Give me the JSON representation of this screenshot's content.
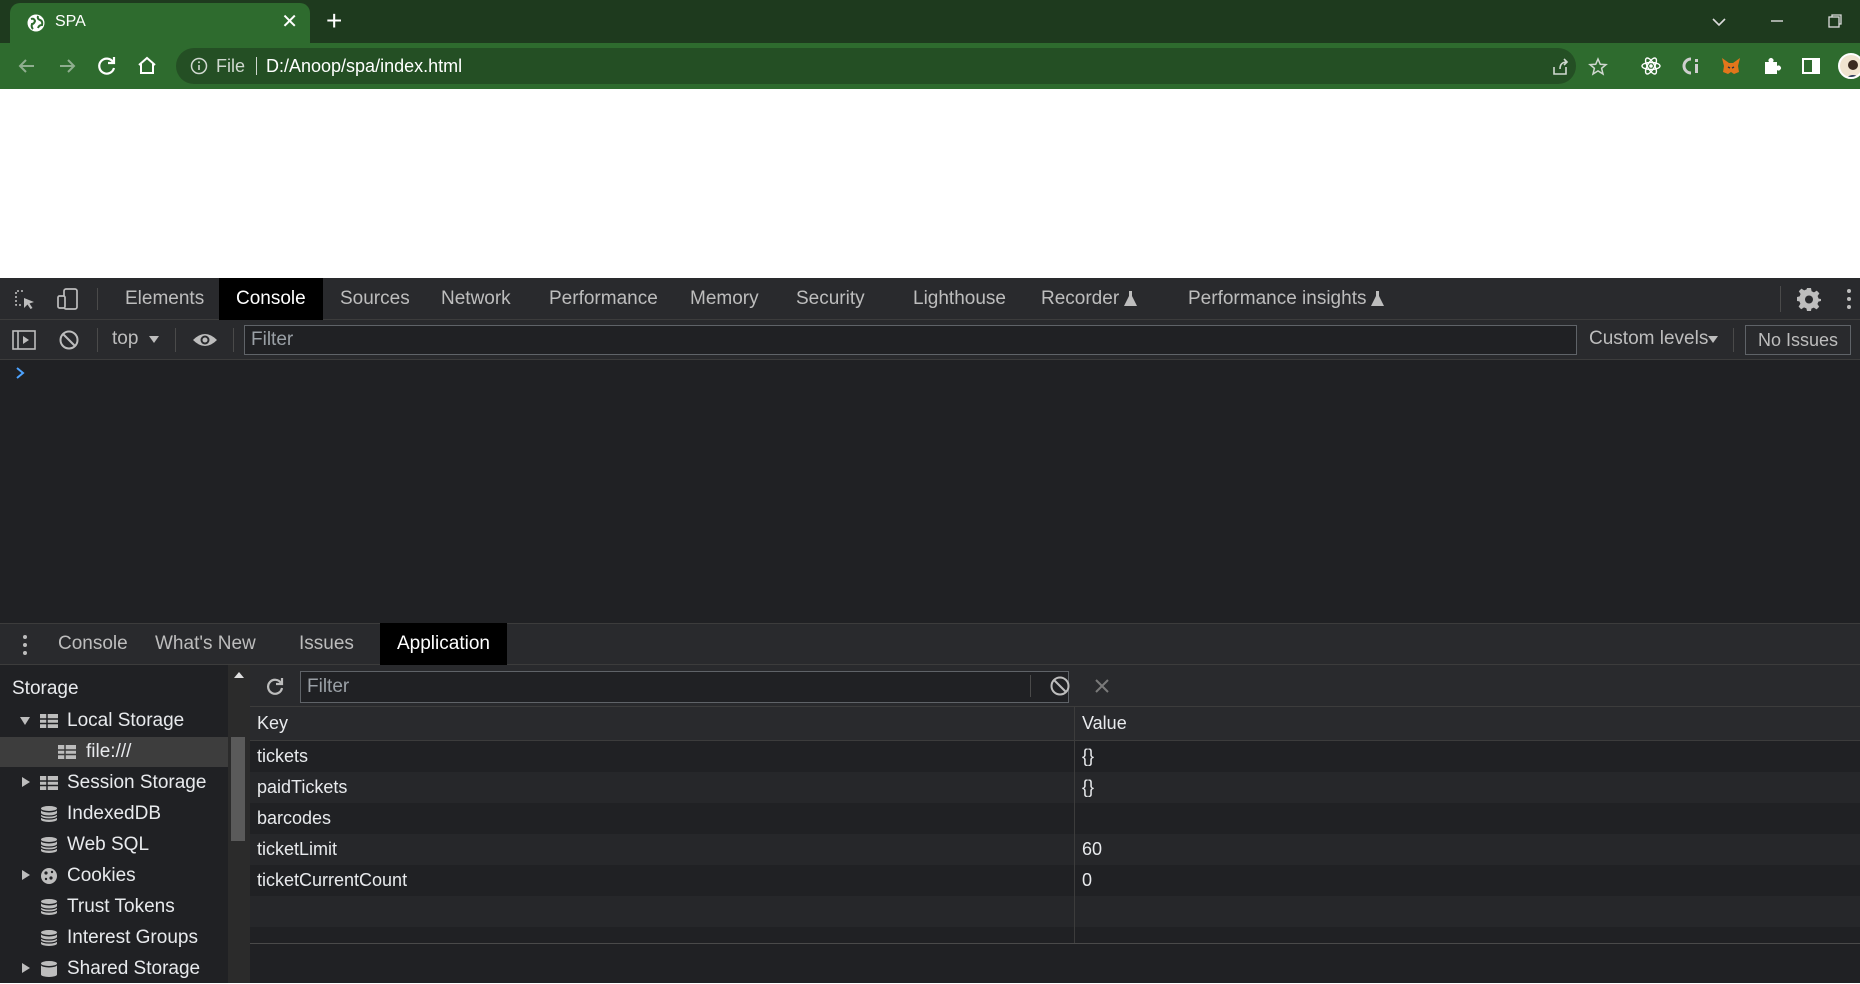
{
  "browser": {
    "tab_title": "SPA",
    "url_scheme": "File",
    "url": "D:/Anoop/spa/index.html"
  },
  "devtools": {
    "tabs": [
      "Elements",
      "Console",
      "Sources",
      "Network",
      "Performance",
      "Memory",
      "Security",
      "Lighthouse",
      "Recorder",
      "Performance insights"
    ],
    "active_tab": "Console",
    "console_toolbar": {
      "context": "top",
      "filter_placeholder": "Filter",
      "levels": "Custom levels",
      "issues": "No Issues"
    },
    "drawer_tabs": [
      "Console",
      "What's New",
      "Issues",
      "Application"
    ],
    "active_drawer_tab": "Application"
  },
  "application": {
    "sidebar_heading": "Storage",
    "tree": [
      {
        "label": "Local Storage",
        "expanded": true
      },
      {
        "label": "file:///",
        "selected": true
      },
      {
        "label": "Session Storage"
      },
      {
        "label": "IndexedDB"
      },
      {
        "label": "Web SQL"
      },
      {
        "label": "Cookies"
      },
      {
        "label": "Trust Tokens"
      },
      {
        "label": "Interest Groups"
      },
      {
        "label": "Shared Storage"
      }
    ],
    "filter_placeholder": "Filter",
    "columns": [
      "Key",
      "Value"
    ],
    "rows": [
      {
        "key": "tickets",
        "value": "{}"
      },
      {
        "key": "paidTickets",
        "value": "{}"
      },
      {
        "key": "barcodes",
        "value": ""
      },
      {
        "key": "ticketLimit",
        "value": "60"
      },
      {
        "key": "ticketCurrentCount",
        "value": "0"
      }
    ]
  },
  "colors": {
    "chrome_frame": "#1e3a1e",
    "chrome_toolbar": "#2e6b2e",
    "devtools_bg": "#202124",
    "accent_blue": "#4da3ff"
  }
}
